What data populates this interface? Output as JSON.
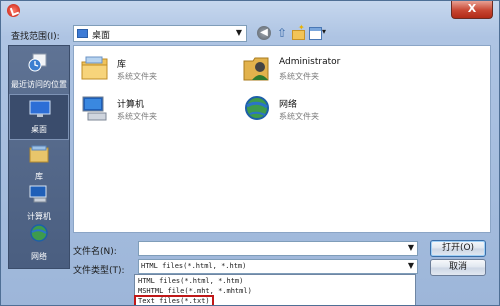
{
  "window": {
    "close": "X"
  },
  "toolbar": {
    "lookin_label": "查找范围(I):",
    "lookin_value": "桌面"
  },
  "places": [
    {
      "label": "最近访问的位置"
    },
    {
      "label": "桌面"
    },
    {
      "label": "库"
    },
    {
      "label": "计算机"
    },
    {
      "label": "网络"
    }
  ],
  "files": [
    {
      "name": "库",
      "type": "系统文件夹"
    },
    {
      "name": "Administrator",
      "type": "系统文件夹"
    },
    {
      "name": "计算机",
      "type": "系统文件夹"
    },
    {
      "name": "网络",
      "type": "系统文件夹"
    }
  ],
  "form": {
    "filename_label": "文件名(N):",
    "filename_value": "",
    "filetype_label": "文件类型(T):",
    "filetype_value": "HTML files(*.html, *.htm)",
    "filetype_options": [
      "HTML files(*.html, *.htm)",
      "MSHTML file(*.mht, *.mhtml)",
      "Text files(*.txt)"
    ]
  },
  "buttons": {
    "open": "打开(O)",
    "cancel": "取消"
  },
  "colors": {
    "highlight_border": "#c01818",
    "selection": "#3d8ee6"
  }
}
